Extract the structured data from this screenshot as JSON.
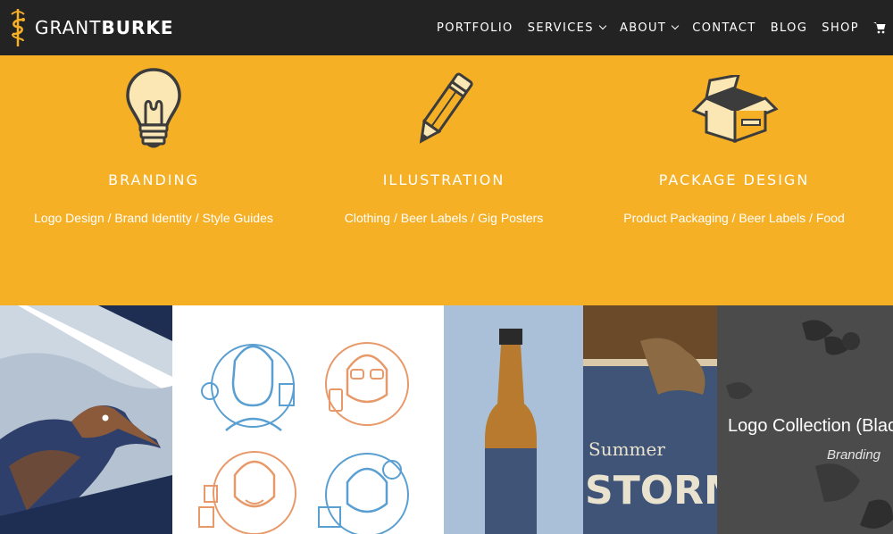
{
  "brand": {
    "name_light": "GRANT",
    "name_bold": "BURKE",
    "colors": {
      "header": "#232323",
      "accent": "#f6b026"
    }
  },
  "nav": {
    "items": [
      {
        "label": "PORTFOLIO",
        "has_dropdown": false
      },
      {
        "label": "SERVICES",
        "has_dropdown": true
      },
      {
        "label": "ABOUT",
        "has_dropdown": true
      },
      {
        "label": "CONTACT",
        "has_dropdown": false
      },
      {
        "label": "BLOG",
        "has_dropdown": false
      },
      {
        "label": "SHOP",
        "has_dropdown": false
      }
    ],
    "cart_icon": "shopping-cart-icon"
  },
  "services": [
    {
      "icon": "lightbulb-icon",
      "title": "BRANDING",
      "description": "Logo Design / Brand Identity / Style Guides"
    },
    {
      "icon": "pencil-icon",
      "title": "ILLUSTRATION",
      "description": "Clothing / Beer Labels / Gig Posters"
    },
    {
      "icon": "open-box-icon",
      "title": "PACKAGE DESIGN",
      "description": "Product Packaging / Beer Labels / Food"
    }
  ],
  "portfolio": {
    "tiles": [
      {
        "subject": "roadrunner-print"
      },
      {
        "subject": "character-icons"
      },
      {
        "subject": "beer-bottles",
        "label_top": "Summer",
        "label_main": "STORM"
      },
      {
        "subject": "logo-collection",
        "title": "Logo Collection (Blac",
        "category": "Branding"
      }
    ]
  }
}
